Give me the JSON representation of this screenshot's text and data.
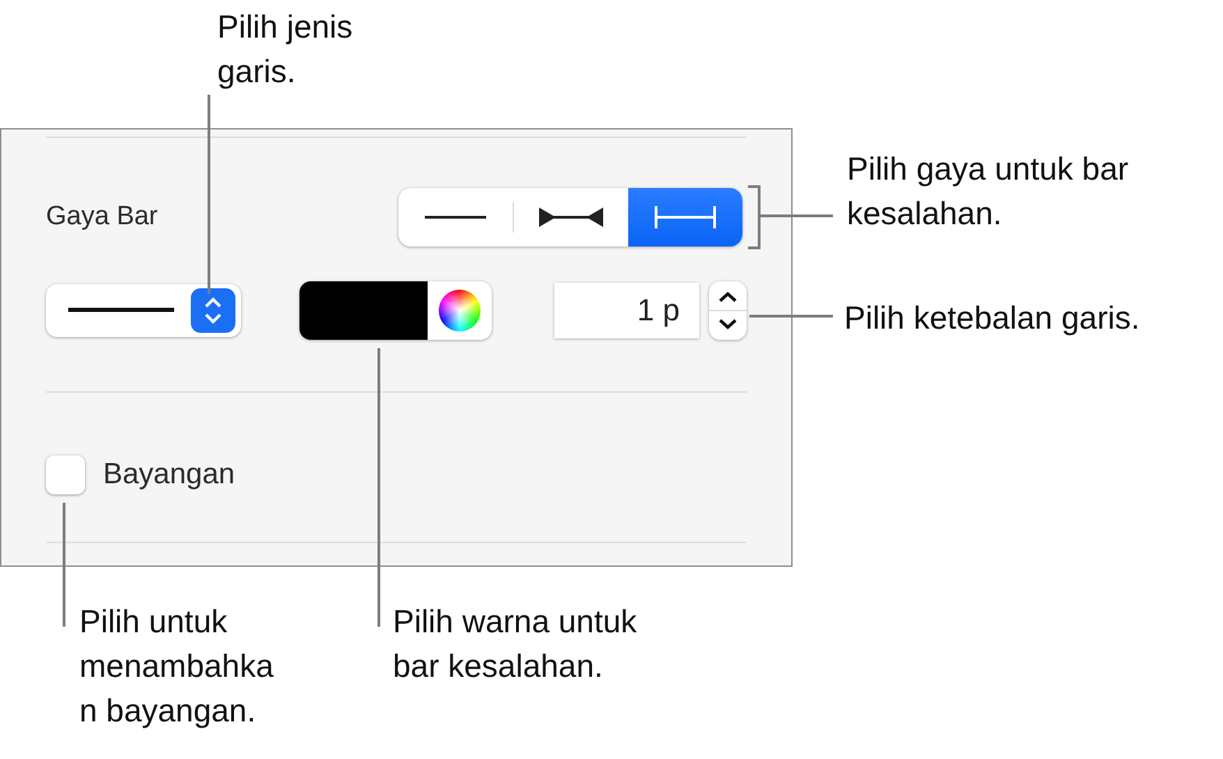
{
  "panel": {
    "section_title": "Gaya Bar",
    "bar_styles": [
      {
        "kind": "plain",
        "selected": false
      },
      {
        "kind": "arrows",
        "selected": false
      },
      {
        "kind": "caps",
        "selected": true
      }
    ],
    "thickness": {
      "value": "1 p"
    },
    "shadow": {
      "label": "Bayangan",
      "checked": false
    }
  },
  "callouts": {
    "line_type": {
      "lines": [
        "Pilih jenis",
        "garis."
      ]
    },
    "bar_style": {
      "lines": [
        "Pilih gaya untuk bar",
        "kesalahan."
      ]
    },
    "thickness": {
      "lines": [
        "Pilih ketebalan garis."
      ]
    },
    "shadow": {
      "lines": [
        "Pilih untuk",
        "menambahka",
        "n bayangan."
      ]
    },
    "color": {
      "lines": [
        "Pilih warna untuk",
        "bar kesalahan."
      ]
    }
  }
}
